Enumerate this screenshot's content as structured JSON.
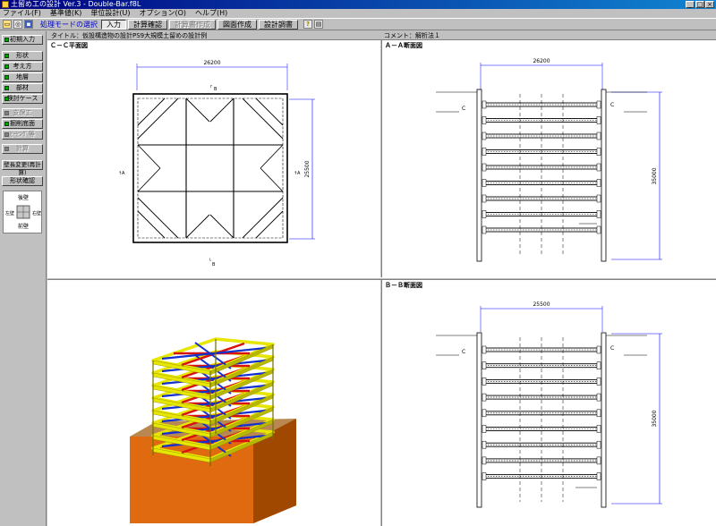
{
  "window": {
    "title": "土留め工の設計 Ver.3 - Double-Bar.f8L"
  },
  "menu": [
    "ファイル(F)",
    "基準値(K)",
    "単位設計(U)",
    "オプション(O)",
    "ヘルプ(H)"
  ],
  "toolbar": {
    "mode_label": "処理モードの選択",
    "buttons": [
      {
        "label": "入力",
        "state": "active"
      },
      {
        "label": "計算確認",
        "state": "normal"
      },
      {
        "label": "計算書作成",
        "state": "disabled"
      },
      {
        "label": "図面作成",
        "state": "normal"
      },
      {
        "label": "設計調書",
        "state": "normal"
      }
    ]
  },
  "sidebar": {
    "buttons": [
      {
        "label": "初期入力",
        "led": true,
        "disabled": false
      },
      {
        "label": "形状",
        "led": true,
        "disabled": false
      },
      {
        "label": "考え方",
        "led": true,
        "disabled": false
      },
      {
        "label": "地層",
        "led": true,
        "disabled": false
      },
      {
        "label": "部材",
        "led": true,
        "disabled": false
      },
      {
        "label": "検討ケース",
        "led": true,
        "disabled": false
      },
      {
        "label": "支保工",
        "led": true,
        "disabled": true
      },
      {
        "label": "掘削底面",
        "led": true,
        "disabled": false
      },
      {
        "label": "ﾋｰﾋﾝｸﾞ等",
        "led": true,
        "disabled": true
      },
      {
        "label": "計算",
        "led": true,
        "disabled": true
      },
      {
        "label": "壁長変更(再計算)",
        "led": false,
        "disabled": false
      },
      {
        "label": "形状確認",
        "led": false,
        "disabled": false
      }
    ],
    "orientation": {
      "top": "後壁",
      "left": "左壁",
      "right": "右壁",
      "bottom": "前壁"
    }
  },
  "infobar": {
    "title": "タイトル：仮設構造物の設計PS9大規模土留めの設計例",
    "comment": "コメント：解析法１"
  },
  "panes": {
    "plan": {
      "label": "Ｃ－Ｃ平面図",
      "width_dim": "26200",
      "height_dim": "25500",
      "marks": {
        "top": "B",
        "bottom": "B",
        "left": "A",
        "right": "A"
      }
    },
    "section_a": {
      "label": "Ａ－Ａ断面図",
      "width_dim": "26200",
      "depth_dim": "35000",
      "marks": {
        "left": "C",
        "right": "C"
      }
    },
    "section_b": {
      "label": "Ｂ－Ｂ断面図",
      "width_dim": "25500",
      "depth_dim": "35000",
      "marks": {
        "left": "C",
        "right": "C"
      }
    },
    "view3d": {
      "label": ""
    }
  },
  "colors": {
    "accent": "#000080",
    "dim": "#0000ff",
    "yellow": "#e6e600",
    "red": "#d81010",
    "blue": "#1030d0",
    "soil": "#e06a10"
  }
}
